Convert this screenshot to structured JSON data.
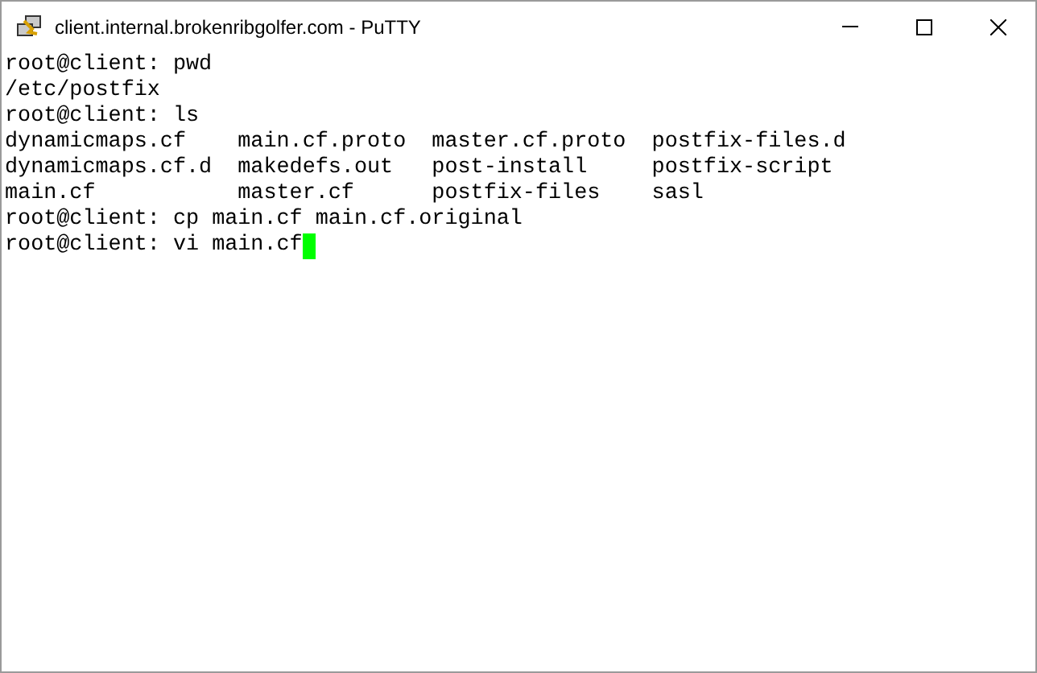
{
  "window": {
    "title": "client.internal.brokenribgolfer.com - PuTTY"
  },
  "terminal": {
    "lines": [
      "root@client: pwd",
      "/etc/postfix",
      "root@client: ls",
      "dynamicmaps.cf    main.cf.proto  master.cf.proto  postfix-files.d",
      "dynamicmaps.cf.d  makedefs.out   post-install     postfix-script",
      "main.cf           master.cf      postfix-files    sasl",
      "root@client: cp main.cf main.cf.original",
      "root@client: vi main.cf"
    ],
    "cursor": true
  }
}
